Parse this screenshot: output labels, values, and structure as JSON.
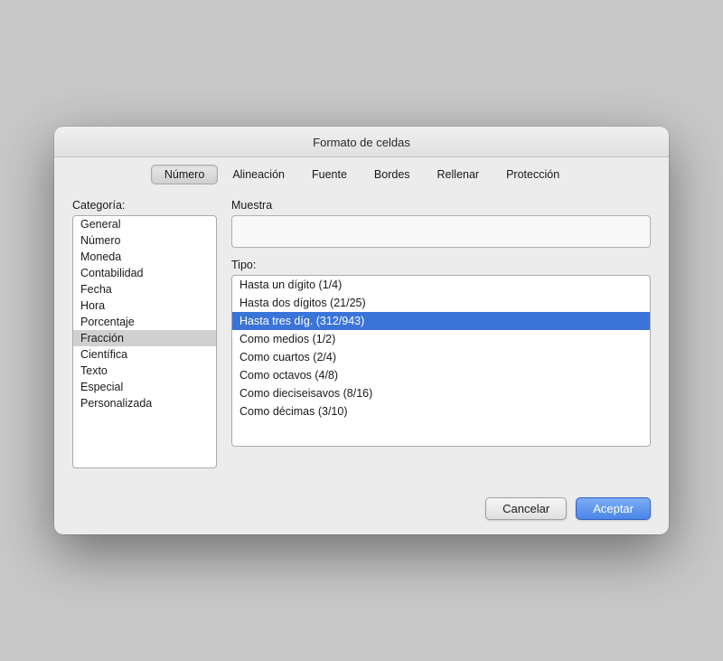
{
  "dialog": {
    "title": "Formato de celdas"
  },
  "tabs": [
    {
      "id": "numero",
      "label": "Número",
      "active": true
    },
    {
      "id": "alineacion",
      "label": "Alineación",
      "active": false
    },
    {
      "id": "fuente",
      "label": "Fuente",
      "active": false
    },
    {
      "id": "bordes",
      "label": "Bordes",
      "active": false
    },
    {
      "id": "rellenar",
      "label": "Rellenar",
      "active": false
    },
    {
      "id": "proteccion",
      "label": "Protección",
      "active": false
    }
  ],
  "left_panel": {
    "label": "Categoría:",
    "categories": [
      {
        "id": "general",
        "label": "General",
        "selected": false
      },
      {
        "id": "numero",
        "label": "Número",
        "selected": false
      },
      {
        "id": "moneda",
        "label": "Moneda",
        "selected": false
      },
      {
        "id": "contabilidad",
        "label": "Contabilidad",
        "selected": false
      },
      {
        "id": "fecha",
        "label": "Fecha",
        "selected": false
      },
      {
        "id": "hora",
        "label": "Hora",
        "selected": false
      },
      {
        "id": "porcentaje",
        "label": "Porcentaje",
        "selected": false
      },
      {
        "id": "fraccion",
        "label": "Fracción",
        "selected": true
      },
      {
        "id": "cientifica",
        "label": "Científica",
        "selected": false
      },
      {
        "id": "texto",
        "label": "Texto",
        "selected": false
      },
      {
        "id": "especial",
        "label": "Especial",
        "selected": false
      },
      {
        "id": "personalizada",
        "label": "Personalizada",
        "selected": false
      }
    ]
  },
  "right_panel": {
    "muestra_label": "Muestra",
    "tipo_label": "Tipo:",
    "tipos": [
      {
        "id": "tipo1",
        "label": "Hasta un dígito (1/4)",
        "selected": false
      },
      {
        "id": "tipo2",
        "label": "Hasta dos dígitos (21/25)",
        "selected": false
      },
      {
        "id": "tipo3",
        "label": "Hasta tres díg. (312/943)",
        "selected": true
      },
      {
        "id": "tipo4",
        "label": "Como medios (1/2)",
        "selected": false
      },
      {
        "id": "tipo5",
        "label": "Como cuartos (2/4)",
        "selected": false
      },
      {
        "id": "tipo6",
        "label": "Como octavos (4/8)",
        "selected": false
      },
      {
        "id": "tipo7",
        "label": "Como dieciseisavos (8/16)",
        "selected": false
      },
      {
        "id": "tipo8",
        "label": "Como décimas (3/10)",
        "selected": false
      }
    ]
  },
  "footer": {
    "cancel_label": "Cancelar",
    "accept_label": "Aceptar"
  }
}
